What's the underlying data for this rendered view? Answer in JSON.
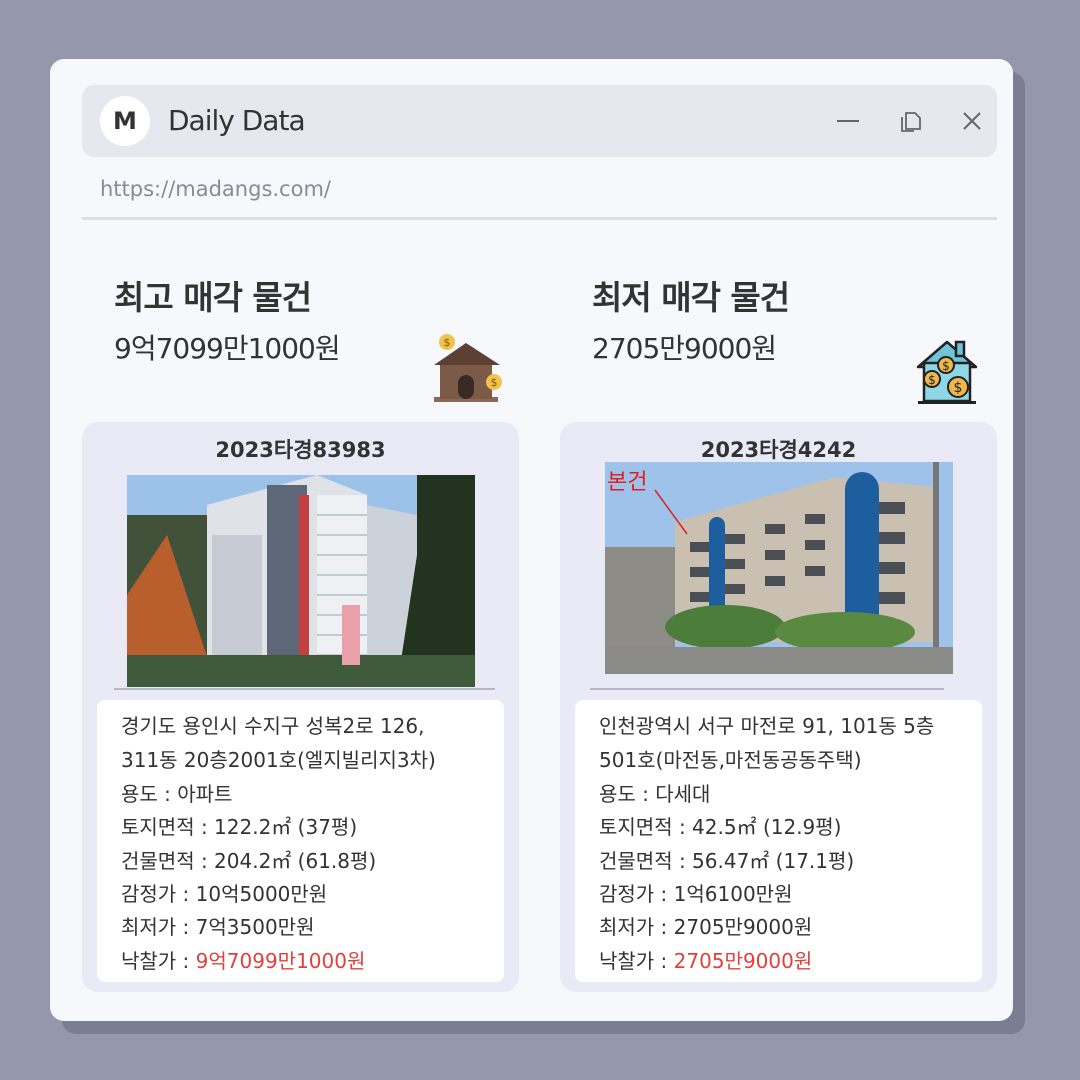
{
  "app": {
    "logo_letter": "M",
    "title": "Daily Data",
    "url": "https://madangs.com/"
  },
  "icons": {
    "minimize": "minimize-icon",
    "restore": "restore-icon",
    "close": "close-icon",
    "house_left": "house-dollar-icon",
    "house_right": "house-coins-icon"
  },
  "highest": {
    "heading": "최고 매각 물건",
    "price": "9억7099만1000원",
    "case_no": "2023타경83983",
    "address1": "경기도 용인시 수지구 성복2로 126,",
    "address2": "311동 20층2001호(엘지빌리지3차)",
    "usage": "용도 : 아파트",
    "land": "토지면적 : 122.2㎡ (37평)",
    "building": "건물면적 : 204.2㎡ (61.8평)",
    "appraisal": "감정가 : 10억5000만원",
    "minimum": "최저가 : 7억3500만원",
    "winning_label": "낙찰가 : ",
    "winning_value": "9억7099만1000원"
  },
  "lowest": {
    "heading": "최저 매각 물건",
    "price": "2705만9000원",
    "case_no": "2023타경4242",
    "photo_label": "본건",
    "address1": "인천광역시 서구 마전로 91, 101동 5층",
    "address2": "501호(마전동,마전동공동주택)",
    "usage": "용도 : 다세대",
    "land": "토지면적 : 42.5㎡ (12.9평)",
    "building": "건물면적 : 56.47㎡ (17.1평)",
    "appraisal": "감정가 : 1억6100만원",
    "minimum": "최저가 : 2705만9000원",
    "winning_label": "낙찰가 : ",
    "winning_value": "2705만9000원"
  },
  "colors": {
    "background": "#9597ac",
    "card": "#e9eaf6",
    "accent_red": "#e0413d"
  }
}
